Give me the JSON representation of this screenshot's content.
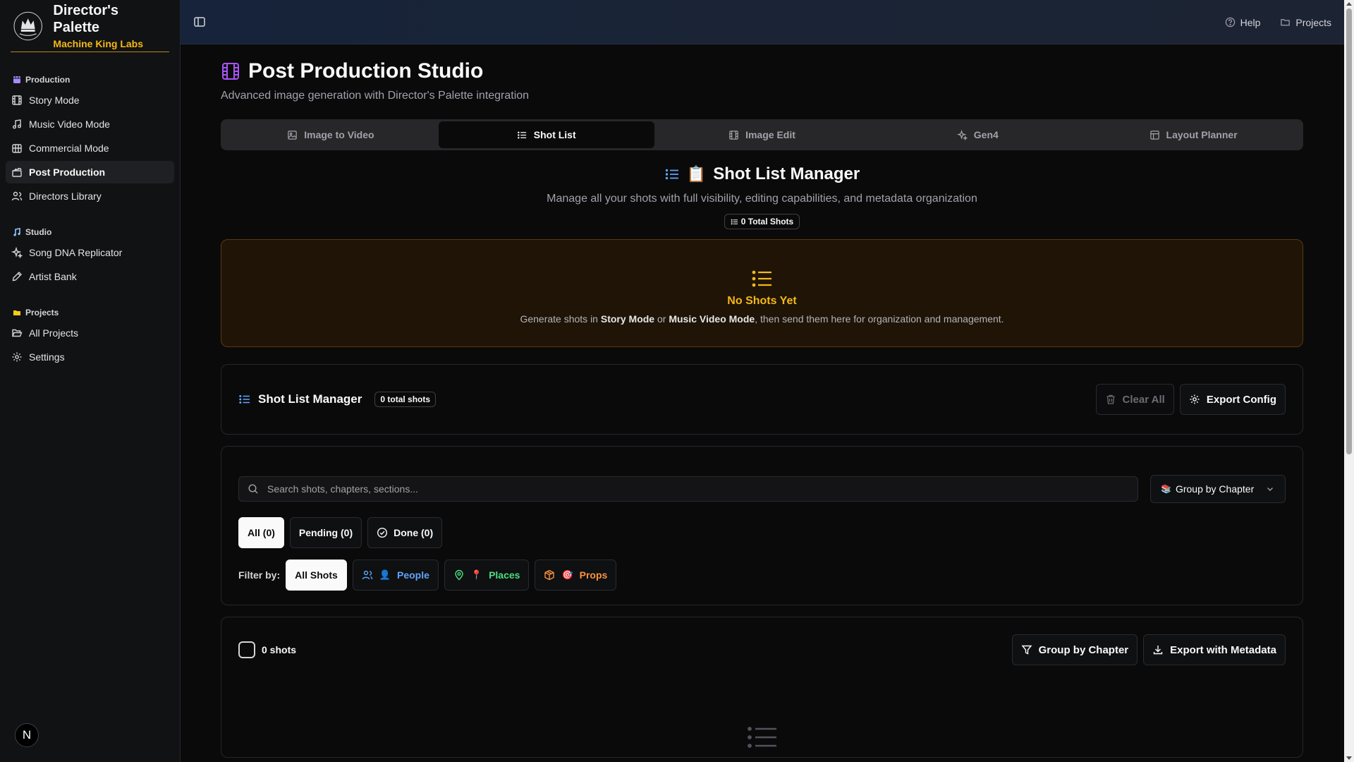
{
  "brand": {
    "title": "Director's Palette",
    "subtitle": "Machine King Labs"
  },
  "sidebar": {
    "groups": [
      {
        "label": "Production",
        "items": [
          {
            "label": "Story Mode",
            "icon": "book-icon"
          },
          {
            "label": "Music Video Mode",
            "icon": "music-icon"
          },
          {
            "label": "Commercial Mode",
            "icon": "briefcase-icon"
          },
          {
            "label": "Post Production",
            "icon": "clapper-icon",
            "active": true
          },
          {
            "label": "Directors Library",
            "icon": "users-icon"
          }
        ]
      },
      {
        "label": "Studio",
        "items": [
          {
            "label": "Song DNA Replicator",
            "icon": "sparkles-icon"
          },
          {
            "label": "Artist Bank",
            "icon": "pen-icon"
          }
        ]
      },
      {
        "label": "Projects",
        "items": [
          {
            "label": "All Projects",
            "icon": "folder-open-icon"
          },
          {
            "label": "Settings",
            "icon": "gear-icon"
          }
        ]
      }
    ],
    "avatar_letter": "N"
  },
  "topbar": {
    "help": "Help",
    "projects": "Projects"
  },
  "page": {
    "title": "Post Production Studio",
    "subtitle": "Advanced image generation with Director's Palette integration"
  },
  "tabs": [
    {
      "label": "Image to Video",
      "icon": "image-icon"
    },
    {
      "label": "Shot List",
      "icon": "list-icon",
      "active": true
    },
    {
      "label": "Image Edit",
      "icon": "film-icon"
    },
    {
      "label": "Gen4",
      "icon": "sparkles-icon"
    },
    {
      "label": "Layout Planner",
      "icon": "layout-icon"
    }
  ],
  "shot_list": {
    "emoji": "📋",
    "title": "Shot List Manager",
    "description": "Manage all your shots with full visibility, editing capabilities, and metadata organization",
    "total_badge": "0 Total Shots"
  },
  "empty_state": {
    "title": "No Shots Yet",
    "desc_prefix": "Generate shots in ",
    "story_mode": "Story Mode",
    "or": " or ",
    "music_video_mode": "Music Video Mode",
    "desc_suffix": ", then send them here for organization and management."
  },
  "manager_card": {
    "title": "Shot List Manager",
    "count": "0 total shots",
    "clear_all": "Clear All",
    "export_config": "Export Config"
  },
  "filters": {
    "search_placeholder": "Search shots, chapters, sections...",
    "group_select_icon": "📚",
    "group_select": "Group by Chapter",
    "status": [
      {
        "label": "All (0)",
        "active": true
      },
      {
        "label": "Pending (0)"
      },
      {
        "label": "Done (0)",
        "icon": "check-circle-icon"
      }
    ],
    "filter_label": "Filter by:",
    "categories": [
      {
        "label": "All Shots",
        "active": true
      },
      {
        "label": "People",
        "emoji": "👤",
        "color": "#60a5fa"
      },
      {
        "label": "Places",
        "emoji": "📍",
        "color": "#4ade80"
      },
      {
        "label": "Props",
        "emoji": "🎯",
        "color": "#fb923c"
      }
    ]
  },
  "list_card": {
    "count": "0 shots",
    "group_button": "Group by Chapter",
    "export_button": "Export with Metadata"
  },
  "colors": {
    "accent_gold": "#f5b816",
    "purple": "#a855f7",
    "blue": "#60a5fa"
  }
}
